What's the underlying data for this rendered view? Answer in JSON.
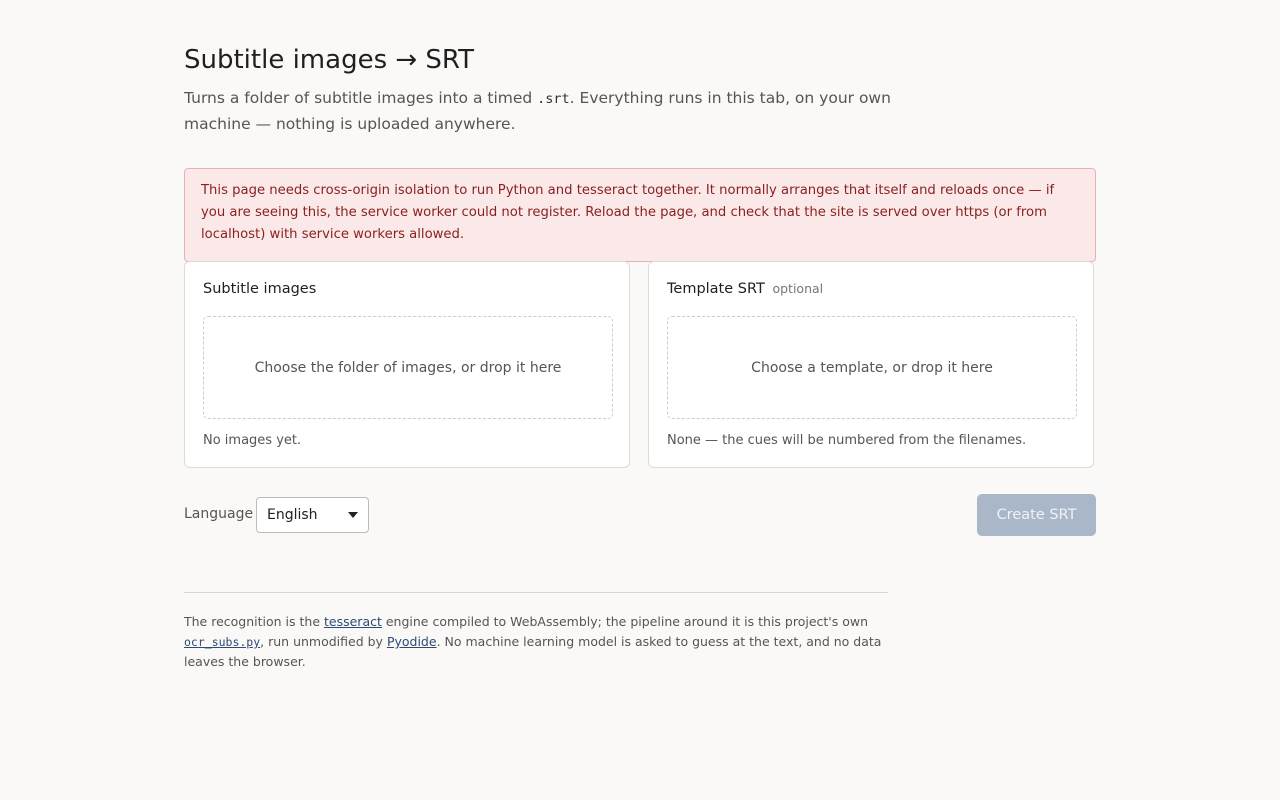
{
  "header": {
    "title": "Subtitle images → SRT",
    "intro_before": "Turns a folder of subtitle images into a timed ",
    "intro_code": ".srt",
    "intro_after": ". Everything runs in this tab, on your own machine — nothing is uploaded anywhere."
  },
  "alert": {
    "text": "This page needs cross-origin isolation to run Python and tesseract together. It normally arranges that itself and reloads once — if you are seeing this, the service worker could not register. Reload the page, and check that the site is served over https (or from localhost) with service workers allowed."
  },
  "images_panel": {
    "title": "Subtitle images",
    "dropzone": "Choose the folder of images, or drop it here",
    "status": "No images yet."
  },
  "template_panel": {
    "title": "Template SRT",
    "optional": "optional",
    "dropzone": "Choose a template, or drop it here",
    "status": "None — the cues will be numbered from the filenames."
  },
  "controls": {
    "language_label": "Language",
    "language_value": "English",
    "create_button": "Create SRT"
  },
  "footer": {
    "part1": "The recognition is the ",
    "link_tesseract": "tesseract",
    "part2": " engine compiled to WebAssembly; the pipeline around it is this project's own ",
    "link_ocr": "ocr_subs.py",
    "part3": ", run unmodified by ",
    "link_pyodide": "Pyodide",
    "part4": ". No machine learning model is asked to guess at the text, and no data leaves the browser."
  },
  "colors": {
    "alert_bg": "#fbe9e9",
    "alert_text": "#8a1f1f",
    "button_disabled": "#a9b7c9",
    "link": "#2b4a78"
  }
}
